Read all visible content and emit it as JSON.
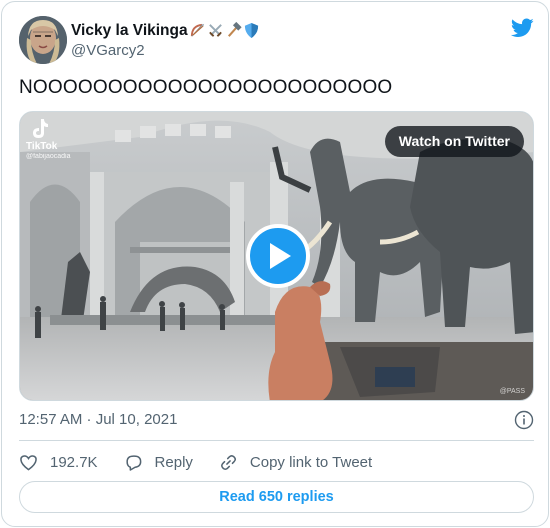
{
  "author": {
    "display_name": "Vicky la Vikinga",
    "handle": "@VGarcy2",
    "name_emojis": [
      "bow-and-arrow-icon",
      "crossed-swords-icon",
      "hammer-icon",
      "shield-icon"
    ]
  },
  "tweet": {
    "text": "NOOOOOOOOOOOOOOOOOOOOOOOO",
    "timestamp": "12:57 AM · Jul 10, 2021"
  },
  "media": {
    "tiktok_label": "TikTok",
    "tiktok_user": "@fabijaocadia",
    "watch_label": "Watch on Twitter",
    "watermark": "@PASS"
  },
  "actions": {
    "like_count": "192.7K",
    "reply_label": "Reply",
    "copy_link_label": "Copy link to Tweet"
  },
  "replies_button": "Read 650 replies",
  "colors": {
    "accent": "#1d9bf0",
    "text": "#0f1419",
    "secondary": "#536471",
    "border": "#cfd9de"
  }
}
